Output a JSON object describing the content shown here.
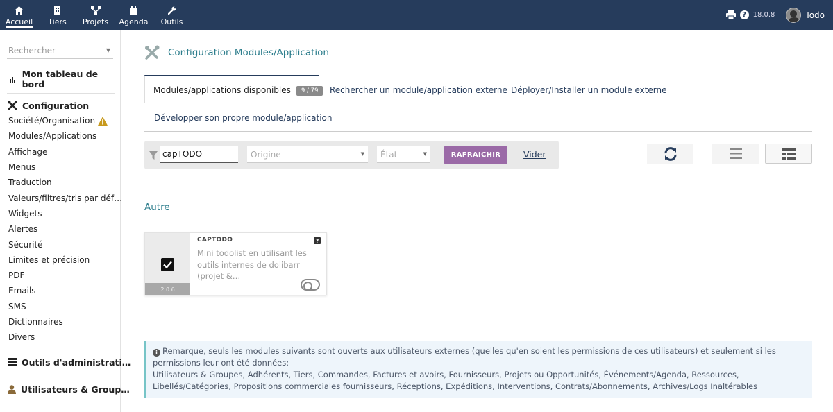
{
  "topbar": {
    "nav": [
      {
        "label": "Accueil",
        "icon": "home-icon"
      },
      {
        "label": "Tiers",
        "icon": "building-icon"
      },
      {
        "label": "Projets",
        "icon": "sitemap-icon"
      },
      {
        "label": "Agenda",
        "icon": "calendar-icon"
      },
      {
        "label": "Outils",
        "icon": "wrench-icon"
      }
    ],
    "version": "18.0.8",
    "user": "Todo",
    "bg_color": "#263c5c"
  },
  "sidebar": {
    "search_placeholder": "Rechercher",
    "dashboard": "Mon tableau de bord",
    "configuration": "Configuration",
    "config_items": [
      "Société/Organisation",
      "Modules/Applications",
      "Affichage",
      "Menus",
      "Traduction",
      "Valeurs/filtres/tris par déf…",
      "Widgets",
      "Alertes",
      "Sécurité",
      "Limites et précision",
      "PDF",
      "Emails",
      "SMS",
      "Dictionnaires",
      "Divers"
    ],
    "admin_tools": "Outils d'administrati…",
    "users_groups": "Utilisateurs & Group…"
  },
  "main": {
    "title": "Configuration Modules/Application",
    "tabs": [
      {
        "label": "Modules/applications disponibles",
        "badge": "9 / 79"
      },
      {
        "label": "Rechercher un module/application externe"
      },
      {
        "label": "Déployer/Installer un module externe"
      },
      {
        "label": "Développer son propre module/application"
      }
    ],
    "filter": {
      "search_value": "capTODO",
      "origin_placeholder": "Origine",
      "state_placeholder": "État",
      "refresh_label": "RAFRAICHIR",
      "clear_label": "Vider"
    },
    "group_title": "Autre",
    "module_card": {
      "name": "CAPTODO",
      "description": "Mini todolist en utilisant les outils internes de dolibarr (projet &…",
      "version": "2.0.6",
      "help": "?",
      "enabled": false
    },
    "note": {
      "line1": "Remarque, seuls les modules suivants sont ouverts aux utilisateurs externes (quelles qu'en soient les permissions de ces utilisateurs) et seulement si les permissions leur ont été données:",
      "line2": "Utilisateurs & Groupes, Adhérents, Tiers, Commandes, Factures et avoirs, Fournisseurs, Projets ou Opportunités, Événements/Agenda, Ressources, Libellés/Catégories, Propositions commerciales fournisseurs, Réceptions, Expéditions, Interventions, Contrats/Abonnements, Archives/Logs Inaltérables"
    },
    "accent_color": "#9b6aa7",
    "title_color": "#2c7d8c"
  }
}
